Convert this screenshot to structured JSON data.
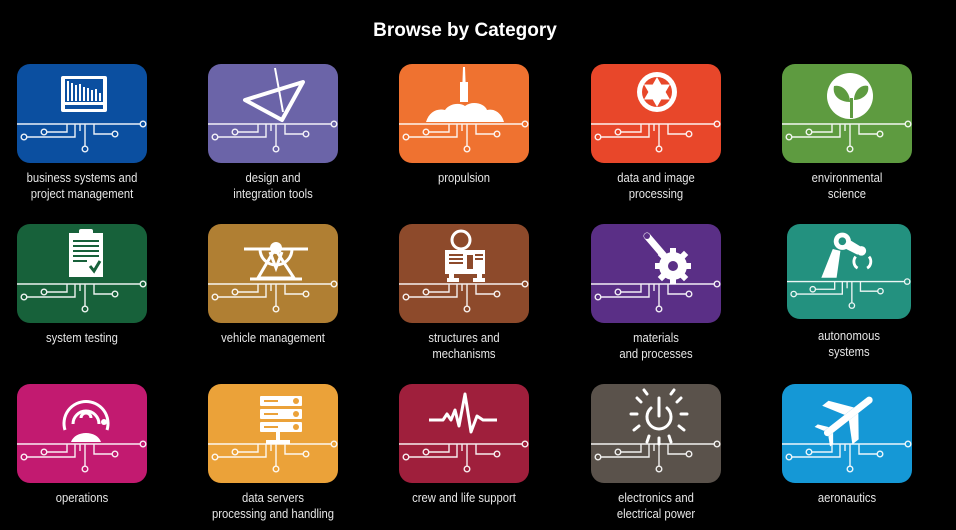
{
  "page": {
    "title": "Browse by Category"
  },
  "categories": [
    {
      "label_lines": [
        "business systems and",
        "project management"
      ],
      "icon": "monitor-chart-icon",
      "color": "#0b4fa0"
    },
    {
      "label_lines": [
        "design and",
        "integration tools"
      ],
      "icon": "drafting-triangle-icon",
      "color": "#6b64a8"
    },
    {
      "label_lines": [
        "propulsion"
      ],
      "icon": "rocket-launch-icon",
      "color": "#ef7230"
    },
    {
      "label_lines": [
        "data and image",
        "processing"
      ],
      "icon": "camera-aperture-icon",
      "color": "#e8472a"
    },
    {
      "label_lines": [
        "environmental",
        "science"
      ],
      "icon": "leaf-sprout-icon",
      "color": "#5e9b40"
    },
    {
      "label_lines": [
        "system testing"
      ],
      "icon": "clipboard-check-icon",
      "color": "#17613a"
    },
    {
      "label_lines": [
        "vehicle management"
      ],
      "icon": "lander-vehicle-icon",
      "color": "#b07f33"
    },
    {
      "label_lines": [
        "structures and",
        "mechanisms"
      ],
      "icon": "machine-structure-icon",
      "color": "#8d4a2b"
    },
    {
      "label_lines": [
        "materials",
        "and processes"
      ],
      "icon": "wrench-gear-icon",
      "color": "#5a2f86"
    },
    {
      "label_lines": [
        "autonomous",
        "systems"
      ],
      "icon": "robot-arm-icon",
      "color": "#23917f"
    },
    {
      "label_lines": [
        "operations"
      ],
      "icon": "operator-headset-icon",
      "color": "#c21a70"
    },
    {
      "label_lines": [
        "data servers",
        "processing and handling"
      ],
      "icon": "server-rack-icon",
      "color": "#eba239"
    },
    {
      "label_lines": [
        "crew and life support"
      ],
      "icon": "heartbeat-icon",
      "color": "#9f1f3c"
    },
    {
      "label_lines": [
        "electronics and",
        "electrical power"
      ],
      "icon": "power-burst-icon",
      "color": "#5a524b"
    },
    {
      "label_lines": [
        "aeronautics"
      ],
      "icon": "airplane-icon",
      "color": "#1598d6"
    }
  ]
}
